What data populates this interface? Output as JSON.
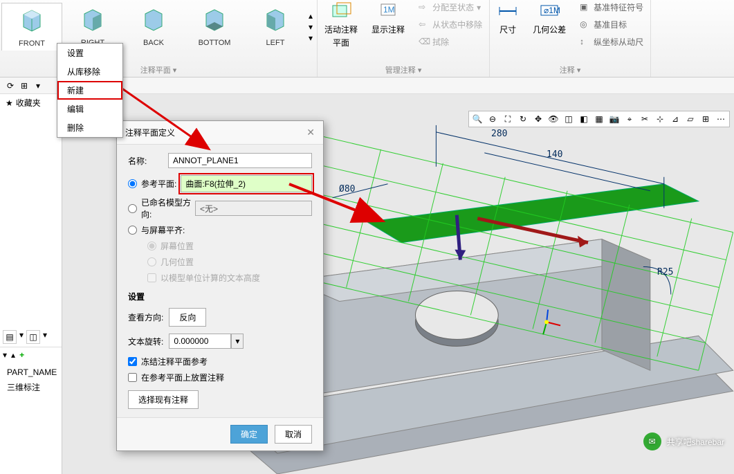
{
  "ribbon": {
    "views": [
      {
        "label": "FRONT"
      },
      {
        "label": "RIGHT"
      },
      {
        "label": "BACK"
      },
      {
        "label": "BOTTOM"
      },
      {
        "label": "LEFT"
      }
    ],
    "group1_label": "注释平面 ▾",
    "active_plane": {
      "line1": "活动注释",
      "line2": "平面"
    },
    "show_annot": "显示注释",
    "manage_label": "管理注释 ▾",
    "assign_state": "分配至状态",
    "from_state": "从状态中移除",
    "erase": "拭除",
    "dim": "尺寸",
    "geotol": "几何公差",
    "feat_sym": "基准特征符号",
    "feat_tgt": "基准目标",
    "vert": "纵坐标从动尺",
    "annot_label": "注释 ▾"
  },
  "context_menu": {
    "items": [
      "设置",
      "从库移除",
      "新建",
      "编辑",
      "删除"
    ]
  },
  "tree": {
    "fav": "收藏夹",
    "part": "PART_NAME",
    "dim": "三维标注"
  },
  "dialog": {
    "title": "注释平面定义",
    "name_lbl": "名称:",
    "name_val": "ANNOT_PLANE1",
    "ref_plane_lbl": "参考平面:",
    "ref_plane_val": "曲面:F8(拉伸_2)",
    "named_dir_lbl": "已命名模型方向:",
    "named_dir_val": "<无>",
    "screen_lbl": "与屏幕平齐:",
    "screen_pos": "屏幕位置",
    "geo_pos": "几何位置",
    "text_h": "以模型单位计算的文本高度",
    "settings": "设置",
    "view_dir_lbl": "查看方向:",
    "view_dir_btn": "反向",
    "text_rot_lbl": "文本旋转:",
    "text_rot_val": "0.000000",
    "freeze": "冻结注释平面参考",
    "place_on": "在参考平面上放置注释",
    "select_exist": "选择现有注释",
    "ok": "确定",
    "cancel": "取消"
  },
  "model": {
    "d1": "280",
    "d2": "140",
    "d3": "Ø80",
    "d4": "R25"
  },
  "watermark": "共享吧sharebar"
}
